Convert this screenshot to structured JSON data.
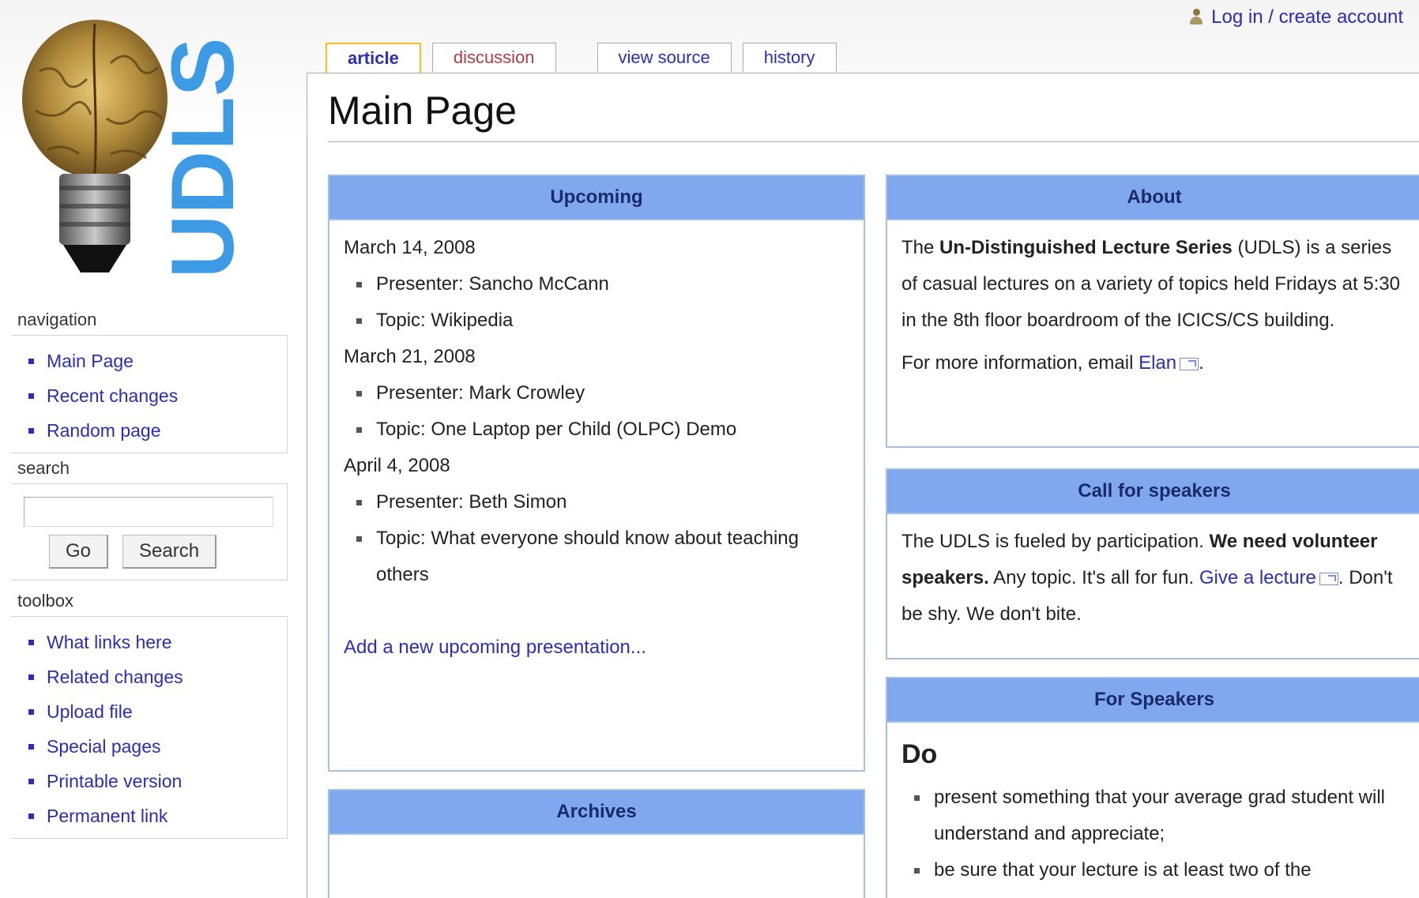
{
  "personal": {
    "login_label": "Log in / create account"
  },
  "logo": {
    "text": "UDLS"
  },
  "sidebar": {
    "navigation": {
      "title": "navigation",
      "items": [
        {
          "label": "Main Page"
        },
        {
          "label": "Recent changes"
        },
        {
          "label": "Random page"
        }
      ]
    },
    "search": {
      "title": "search",
      "value": "",
      "go_label": "Go",
      "search_label": "Search"
    },
    "toolbox": {
      "title": "toolbox",
      "items": [
        {
          "label": "What links here"
        },
        {
          "label": "Related changes"
        },
        {
          "label": "Upload file"
        },
        {
          "label": "Special pages"
        },
        {
          "label": "Printable version"
        },
        {
          "label": "Permanent link"
        }
      ]
    }
  },
  "tabs": {
    "article": "article",
    "discussion": "discussion",
    "view_source": "view source",
    "history": "history"
  },
  "page_title": "Main Page",
  "upcoming": {
    "title": "Upcoming",
    "entries": [
      {
        "date": "March 14, 2008",
        "presenter": "Presenter: Sancho McCann",
        "topic": "Topic: Wikipedia"
      },
      {
        "date": "March 21, 2008",
        "presenter": "Presenter: Mark Crowley",
        "topic": "Topic: One Laptop per Child (OLPC) Demo"
      },
      {
        "date": "April 4, 2008",
        "presenter": "Presenter: Beth Simon",
        "topic": "Topic: What everyone should know about teaching others"
      }
    ],
    "add_link": "Add a new upcoming presentation..."
  },
  "archives": {
    "title": "Archives"
  },
  "about": {
    "title": "About",
    "intro_prefix": "The ",
    "series_name": "Un-Distinguished Lecture Series",
    "intro_rest": " (UDLS) is a series of casual lectures on a variety of topics held Fridays at 5:30 in the 8th floor boardroom of the ICICS/CS building.",
    "email_prefix": "For more information, email ",
    "email_link": "Elan",
    "email_suffix": "."
  },
  "call_for_speakers": {
    "title": "Call for speakers",
    "text1": "The UDLS is fueled by participation. ",
    "bold": "We need volunteer speakers.",
    "text2": " Any topic. It's all for fun. ",
    "link": "Give a lecture",
    "text3": ". Don't be shy. We don't bite."
  },
  "for_speakers": {
    "title": "For Speakers",
    "do_heading": "Do",
    "items": [
      "present something that your average grad student will understand and appreciate;",
      "be sure that your lecture is at least two of the"
    ]
  }
}
